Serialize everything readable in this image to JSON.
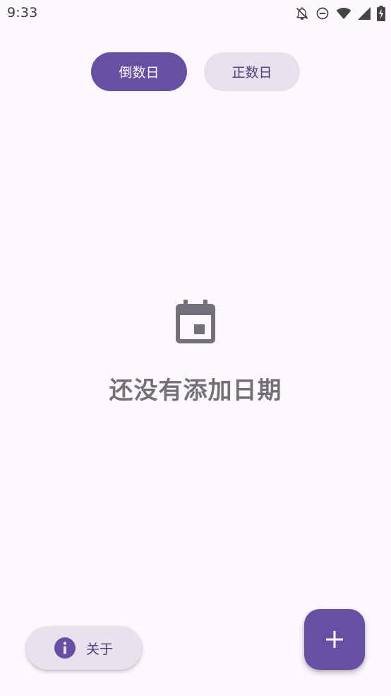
{
  "status_bar": {
    "time": "9:33",
    "icons": [
      "notifications-off-icon",
      "do-not-disturb-icon",
      "wifi-icon",
      "cellular-signal-icon",
      "battery-charging-icon"
    ]
  },
  "tabs": [
    {
      "label": "倒数日",
      "active": true
    },
    {
      "label": "正数日",
      "active": false
    }
  ],
  "empty_state": {
    "icon": "calendar-icon",
    "message": "还没有添加日期"
  },
  "about_button": {
    "icon": "info-icon",
    "label": "关于"
  },
  "fab": {
    "icon": "add-icon"
  },
  "colors": {
    "primary": "#6750a4",
    "background": "#fef7ff",
    "tab_inactive_bg": "#e8e0ec",
    "muted_text": "#74707a"
  }
}
